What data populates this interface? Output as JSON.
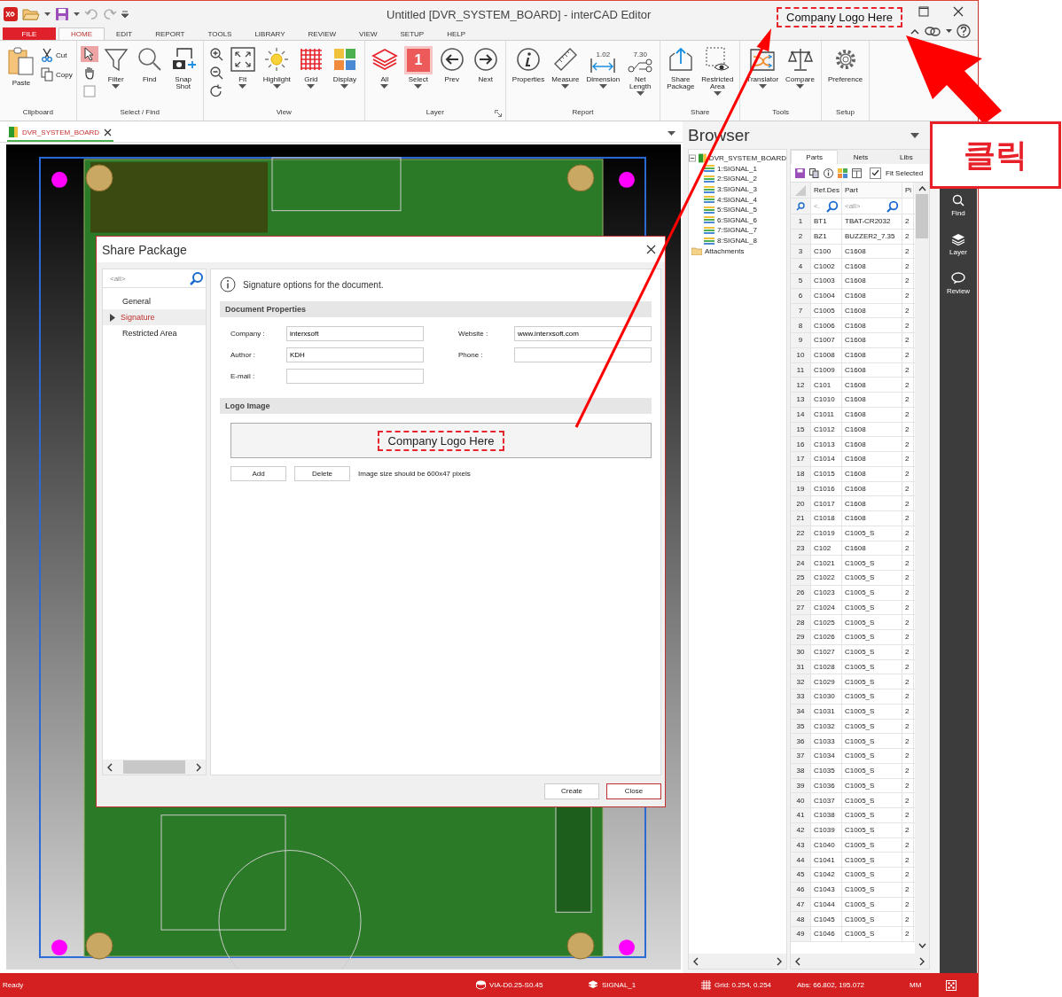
{
  "window": {
    "title": "Untitled [DVR_SYSTEM_BOARD] - interCAD Editor",
    "logo_text": "Company Logo Here"
  },
  "menu_tabs": [
    {
      "label": "FILE",
      "kind": "file",
      "selected": false
    },
    {
      "label": "HOME",
      "kind": "tab",
      "selected": true
    },
    {
      "label": "EDIT",
      "kind": "tab",
      "selected": false
    },
    {
      "label": "REPORT",
      "kind": "tab",
      "selected": false
    },
    {
      "label": "TOOLS",
      "kind": "tab",
      "selected": false
    },
    {
      "label": "LIBRARY",
      "kind": "tab",
      "selected": false
    },
    {
      "label": "REVIEW",
      "kind": "tab",
      "selected": false
    },
    {
      "label": "VIEW",
      "kind": "tab",
      "selected": false
    },
    {
      "label": "SETUP",
      "kind": "tab",
      "selected": false
    },
    {
      "label": "HELP",
      "kind": "tab",
      "selected": false
    }
  ],
  "ribbon": [
    {
      "label": "Clipboard",
      "buttons": [
        {
          "label": "Paste",
          "kind": "paste",
          "menu": false
        }
      ],
      "small_buttons": [
        {
          "label": "Cut",
          "kind": "cut"
        },
        {
          "label": "Copy",
          "kind": "copy"
        }
      ]
    },
    {
      "label": "Select / Find",
      "tools": [
        {
          "kind": "pointer",
          "selected": true
        },
        {
          "kind": "hand",
          "selected": false
        },
        {
          "kind": "box",
          "selected": false
        }
      ],
      "buttons": [
        {
          "label": "Filter",
          "kind": "filter",
          "menu": true
        },
        {
          "label": "Find",
          "kind": "find",
          "menu": false
        },
        {
          "label": "Snap Shot",
          "kind": "snapshot",
          "menu": false
        }
      ]
    },
    {
      "label": "View",
      "tools": [
        {
          "kind": "zoomin",
          "selected": false
        },
        {
          "kind": "zoomout",
          "selected": false
        },
        {
          "kind": "rotate",
          "selected": false
        }
      ],
      "buttons": [
        {
          "label": "Fit",
          "kind": "fit",
          "menu": true
        },
        {
          "label": "Highlight",
          "kind": "highlight",
          "menu": true
        },
        {
          "label": "Grid",
          "kind": "grid",
          "menu": true
        },
        {
          "label": "Display",
          "kind": "display",
          "menu": true
        }
      ]
    },
    {
      "label": "Layer",
      "buttons": [
        {
          "label": "All",
          "kind": "layers",
          "menu": true
        },
        {
          "label": "Select",
          "kind": "badge",
          "icon_text": "1",
          "menu": true
        },
        {
          "label": "Prev",
          "kind": "prev",
          "menu": false
        },
        {
          "label": "Next",
          "kind": "next",
          "menu": false
        }
      ]
    },
    {
      "label": "Report",
      "buttons": [
        {
          "label": "Properties",
          "kind": "info",
          "menu": false
        },
        {
          "label": "Measure",
          "kind": "ruler",
          "menu": true
        },
        {
          "label": "Dimension",
          "kind": "dimension",
          "icon_text": "1.02",
          "menu": true
        },
        {
          "label": "Net Length",
          "kind": "netlength",
          "icon_text": "7.30",
          "menu": true
        }
      ]
    },
    {
      "label": "Share",
      "buttons": [
        {
          "label": "Share Package",
          "kind": "share",
          "menu": false
        },
        {
          "label": "Restricted Area",
          "kind": "restricted",
          "menu": true
        }
      ]
    },
    {
      "label": "Tools",
      "buttons": [
        {
          "label": "Translator",
          "kind": "translator",
          "menu": true
        },
        {
          "label": "Compare",
          "kind": "compare",
          "menu": true
        }
      ]
    },
    {
      "label": "Setup",
      "buttons": [
        {
          "label": "Preference",
          "kind": "gear",
          "menu": false
        }
      ]
    }
  ],
  "document_tab": {
    "label": "DVR_SYSTEM_BOARD"
  },
  "dialog": {
    "title": "Share Package",
    "search_placeholder": "<all>",
    "nav": [
      {
        "label": "General",
        "selected": false
      },
      {
        "label": "Signature",
        "selected": true
      },
      {
        "label": "Restricted Area",
        "selected": false
      }
    ],
    "info": "Signature options for the document.",
    "sections": [
      {
        "title": "Document Properties"
      },
      {
        "title": "Logo Image"
      }
    ],
    "fields": [
      {
        "label": "Company :",
        "value": "interxsoft"
      },
      {
        "label": "Website :",
        "value": "www.interxsoft.com"
      },
      {
        "label": "Author :",
        "value": "KDH"
      },
      {
        "label": "Phone :"
      },
      {
        "label": "E-mail :"
      }
    ],
    "logo_text": "Company Logo Here",
    "logo_buttons": [
      "Add",
      "Delete"
    ],
    "logo_note": "Image size should be 600x47 pixels",
    "buttons": [
      {
        "label": "Create",
        "default": false
      },
      {
        "label": "Close",
        "default": true
      }
    ]
  },
  "browser": {
    "title": "Browser",
    "tree": [
      {
        "label": "DVR_SYSTEM_BOARD",
        "kind": "board",
        "expanded": true,
        "children": [
          {
            "label": "1:SIGNAL_1",
            "kind": "layer"
          },
          {
            "label": "2:SIGNAL_2",
            "kind": "layer"
          },
          {
            "label": "3:SIGNAL_3",
            "kind": "layer"
          },
          {
            "label": "4:SIGNAL_4",
            "kind": "layer"
          },
          {
            "label": "5:SIGNAL_5",
            "kind": "layer"
          },
          {
            "label": "6:SIGNAL_6",
            "kind": "layer"
          },
          {
            "label": "7:SIGNAL_7",
            "kind": "layer"
          },
          {
            "label": "8:SIGNAL_8",
            "kind": "layer"
          }
        ]
      },
      {
        "label": "Attachments",
        "kind": "folder"
      }
    ],
    "tabs": [
      {
        "label": "Parts",
        "selected": true
      },
      {
        "label": "Nets",
        "selected": false
      },
      {
        "label": "Libs",
        "selected": false
      }
    ],
    "fit_selected": {
      "label": "Fit Selected",
      "checked": true
    },
    "table": {
      "columns": [
        "Ref.Des",
        "Part",
        "Pi"
      ],
      "filters": [
        "<.",
        "<all>"
      ],
      "rows": [
        {
          "index": "1",
          "ref": "BT1",
          "part": "TBAT-CR2032",
          "pins": "2"
        },
        {
          "index": "2",
          "ref": "BZ1",
          "part": "BUZZER2_7.35",
          "pins": "2"
        },
        {
          "index": "3",
          "ref": "C100",
          "part": "C1608",
          "pins": "2"
        },
        {
          "index": "4",
          "ref": "C1002",
          "part": "C1608",
          "pins": "2"
        },
        {
          "index": "5",
          "ref": "C1003",
          "part": "C1608",
          "pins": "2"
        },
        {
          "index": "6",
          "ref": "C1004",
          "part": "C1608",
          "pins": "2"
        },
        {
          "index": "7",
          "ref": "C1005",
          "part": "C1608",
          "pins": "2"
        },
        {
          "index": "8",
          "ref": "C1006",
          "part": "C1608",
          "pins": "2"
        },
        {
          "index": "9",
          "ref": "C1007",
          "part": "C1608",
          "pins": "2"
        },
        {
          "index": "10",
          "ref": "C1008",
          "part": "C1608",
          "pins": "2"
        },
        {
          "index": "11",
          "ref": "C1009",
          "part": "C1608",
          "pins": "2"
        },
        {
          "index": "12",
          "ref": "C101",
          "part": "C1608",
          "pins": "2"
        },
        {
          "index": "13",
          "ref": "C1010",
          "part": "C1608",
          "pins": "2"
        },
        {
          "index": "14",
          "ref": "C1011",
          "part": "C1608",
          "pins": "2"
        },
        {
          "index": "15",
          "ref": "C1012",
          "part": "C1608",
          "pins": "2"
        },
        {
          "index": "16",
          "ref": "C1013",
          "part": "C1608",
          "pins": "2"
        },
        {
          "index": "17",
          "ref": "C1014",
          "part": "C1608",
          "pins": "2"
        },
        {
          "index": "18",
          "ref": "C1015",
          "part": "C1608",
          "pins": "2"
        },
        {
          "index": "19",
          "ref": "C1016",
          "part": "C1608",
          "pins": "2"
        },
        {
          "index": "20",
          "ref": "C1017",
          "part": "C1608",
          "pins": "2"
        },
        {
          "index": "21",
          "ref": "C1018",
          "part": "C1608",
          "pins": "2"
        },
        {
          "index": "22",
          "ref": "C1019",
          "part": "C1005_S",
          "pins": "2"
        },
        {
          "index": "23",
          "ref": "C102",
          "part": "C1608",
          "pins": "2"
        },
        {
          "index": "24",
          "ref": "C1021",
          "part": "C1005_S",
          "pins": "2"
        },
        {
          "index": "25",
          "ref": "C1022",
          "part": "C1005_S",
          "pins": "2"
        },
        {
          "index": "26",
          "ref": "C1023",
          "part": "C1005_S",
          "pins": "2"
        },
        {
          "index": "27",
          "ref": "C1024",
          "part": "C1005_S",
          "pins": "2"
        },
        {
          "index": "28",
          "ref": "C1025",
          "part": "C1005_S",
          "pins": "2"
        },
        {
          "index": "29",
          "ref": "C1026",
          "part": "C1005_S",
          "pins": "2"
        },
        {
          "index": "30",
          "ref": "C1027",
          "part": "C1005_S",
          "pins": "2"
        },
        {
          "index": "31",
          "ref": "C1028",
          "part": "C1005_S",
          "pins": "2"
        },
        {
          "index": "32",
          "ref": "C1029",
          "part": "C1005_S",
          "pins": "2"
        },
        {
          "index": "33",
          "ref": "C1030",
          "part": "C1005_S",
          "pins": "2"
        },
        {
          "index": "34",
          "ref": "C1031",
          "part": "C1005_S",
          "pins": "2"
        },
        {
          "index": "35",
          "ref": "C1032",
          "part": "C1005_S",
          "pins": "2"
        },
        {
          "index": "36",
          "ref": "C1033",
          "part": "C1005_S",
          "pins": "2"
        },
        {
          "index": "37",
          "ref": "C1034",
          "part": "C1005_S",
          "pins": "2"
        },
        {
          "index": "38",
          "ref": "C1035",
          "part": "C1005_S",
          "pins": "2"
        },
        {
          "index": "39",
          "ref": "C1036",
          "part": "C1005_S",
          "pins": "2"
        },
        {
          "index": "40",
          "ref": "C1037",
          "part": "C1005_S",
          "pins": "2"
        },
        {
          "index": "41",
          "ref": "C1038",
          "part": "C1005_S",
          "pins": "2"
        },
        {
          "index": "42",
          "ref": "C1039",
          "part": "C1005_S",
          "pins": "2"
        },
        {
          "index": "43",
          "ref": "C1040",
          "part": "C1005_S",
          "pins": "2"
        },
        {
          "index": "44",
          "ref": "C1041",
          "part": "C1005_S",
          "pins": "2"
        },
        {
          "index": "45",
          "ref": "C1042",
          "part": "C1005_S",
          "pins": "2"
        },
        {
          "index": "46",
          "ref": "C1043",
          "part": "C1005_S",
          "pins": "2"
        },
        {
          "index": "47",
          "ref": "C1044",
          "part": "C1005_S",
          "pins": "2"
        },
        {
          "index": "48",
          "ref": "C1045",
          "part": "C1005_S",
          "pins": "2"
        },
        {
          "index": "49",
          "ref": "C1046",
          "part": "C1005_S",
          "pins": "2"
        }
      ]
    }
  },
  "side_bar": [
    {
      "label": "Find",
      "kind": "find"
    },
    {
      "label": "Layer",
      "kind": "layers"
    },
    {
      "label": "Review",
      "kind": "review"
    }
  ],
  "status_bar": [
    {
      "label": "Ready",
      "kind": "text"
    },
    {
      "label": "VIA-D0.25-S0.45",
      "kind": "via"
    },
    {
      "label": "SIGNAL_1",
      "kind": "layer"
    },
    {
      "label": "Grid: 0.254, 0.254",
      "kind": "grid"
    },
    {
      "label": "Abs: 66.802, 195.072",
      "kind": "text"
    },
    {
      "label": "MM",
      "kind": "text"
    }
  ],
  "annotation": {
    "label": "클릭"
  }
}
